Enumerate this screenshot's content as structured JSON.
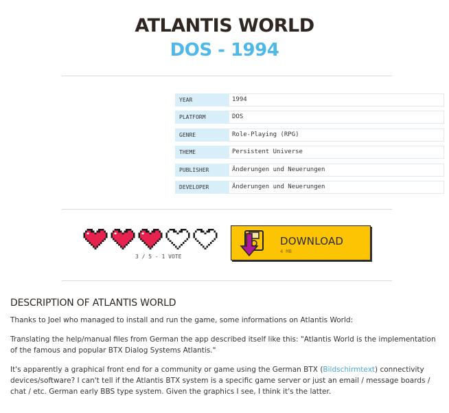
{
  "header": {
    "title": "ATLANTIS WORLD",
    "subtitle": "DOS - 1994"
  },
  "info": [
    {
      "key": "YEAR",
      "value": "1994"
    },
    {
      "key": "PLATFORM",
      "value": "DOS"
    },
    {
      "key": "GENRE",
      "value": "Role-Playing (RPG)"
    },
    {
      "key": "THEME",
      "value": "Persistent Universe"
    },
    {
      "key": "PUBLISHER",
      "value": "Änderungen und Neuerungen"
    },
    {
      "key": "DEVELOPER",
      "value": "Änderungen und Neuerungen"
    }
  ],
  "rating": {
    "filled": 3,
    "total": 5,
    "label": "3 / 5 - 1 VOTE"
  },
  "download": {
    "label": "DOWNLOAD",
    "size": "4 MB"
  },
  "description": {
    "title": "DESCRIPTION OF ATLANTIS WORLD",
    "p1": "Thanks to Joel who managed to install and run the game, some informations on Atlantis World:",
    "p2": "Translating the help/manual files from German the app described itself like this: \"Atlantis World is the implementation of the famous and popular BTX Dialog Systems Atlantis.\"",
    "p3_before": "It's apparently a graphical front end for a community or game using the German BTX (",
    "p3_link": "Bildschirmtext",
    "p3_after": ") connectivity devices/software? I can't tell if the Atlantis BTX system is a specific game server or just an email / message boards / chat / etc. German early BBS type system. Given the graphics I see, I think it's the latter."
  },
  "colors": {
    "heart_fill": "#e8224f",
    "heart_outline": "#1a1a1a",
    "accent_blue": "#4fb8e8",
    "download_bg": "#fcc403"
  }
}
